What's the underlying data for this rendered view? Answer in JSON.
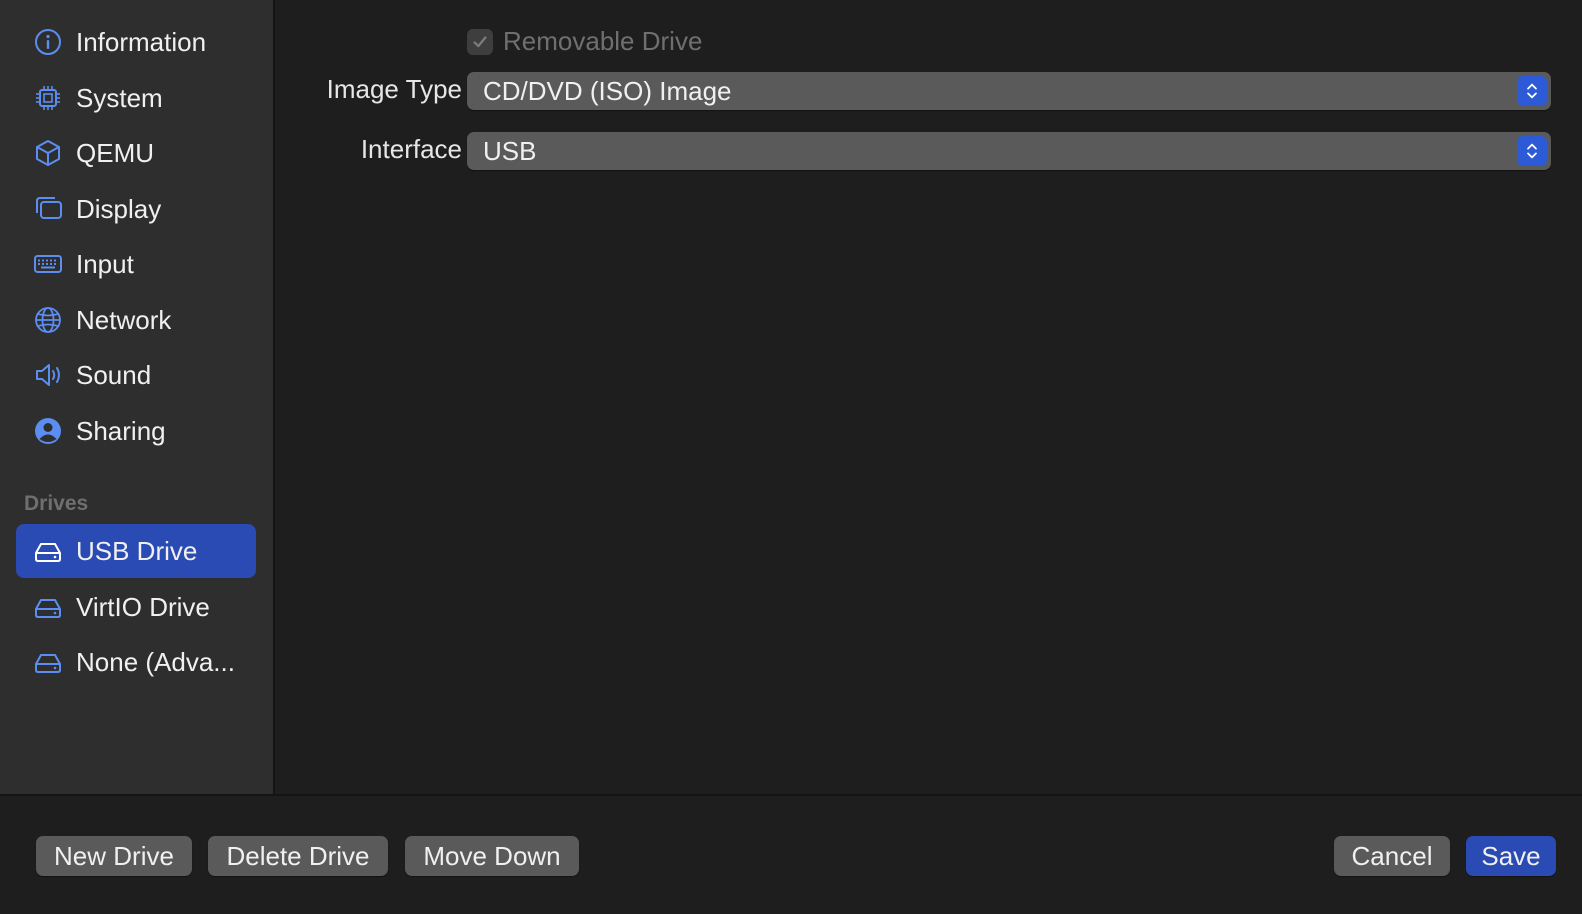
{
  "sidebar": {
    "items": [
      {
        "label": "Information",
        "icon": "info-icon"
      },
      {
        "label": "System",
        "icon": "cpu-icon"
      },
      {
        "label": "QEMU",
        "icon": "cube-icon"
      },
      {
        "label": "Display",
        "icon": "display-icon"
      },
      {
        "label": "Input",
        "icon": "keyboard-icon"
      },
      {
        "label": "Network",
        "icon": "globe-icon"
      },
      {
        "label": "Sound",
        "icon": "speaker-icon"
      },
      {
        "label": "Sharing",
        "icon": "person-icon"
      }
    ],
    "drives_header": "Drives",
    "drives": [
      {
        "label": "USB Drive",
        "icon": "drive-icon",
        "selected": true
      },
      {
        "label": "VirtIO Drive",
        "icon": "drive-icon",
        "selected": false
      },
      {
        "label": "None (Adva...",
        "icon": "drive-icon",
        "selected": false
      }
    ]
  },
  "main": {
    "removable_label": "Removable Drive",
    "removable_checked": true,
    "image_type_label": "Image Type",
    "image_type_value": "CD/DVD (ISO) Image",
    "interface_label": "Interface",
    "interface_value": "USB"
  },
  "footer": {
    "new_drive": "New Drive",
    "delete_drive": "Delete Drive",
    "move_down": "Move Down",
    "cancel": "Cancel",
    "save": "Save"
  },
  "colors": {
    "accent": "#2a4bb3",
    "icon_blue": "#5b8ef0",
    "sidebar_bg": "#2e2e2f",
    "content_bg": "#1e1e1e"
  }
}
